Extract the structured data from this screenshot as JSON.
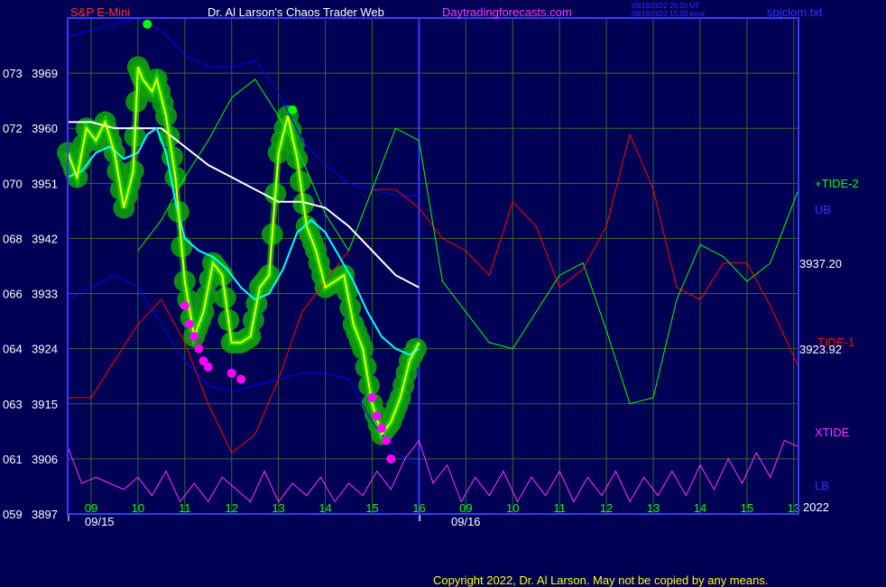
{
  "header": {
    "symbol": "S&P E-Mini",
    "author": "Dr. Al Larson's Chaos Trader Web",
    "site": "Daytradingforecasts.com",
    "timestamp_ut": "09/16/2022 20:20 UT",
    "timestamp_local": "09/16/2022 15:20 local",
    "filename": "spjclom.txt"
  },
  "footer": {
    "copyright": "Copyright 2022, Dr. Al Larson. May not be copied by any means."
  },
  "colors": {
    "background": "#000055",
    "frame": "#3a3aff",
    "grid": "#2f6b2f",
    "price": "#ffff00",
    "bands": "#00ff00",
    "ma_fast": "#00ffff",
    "ma_slow": "#ffffff",
    "tide2": "#00ff00",
    "tide1": "#ff0000",
    "xtide": "#ff33ff",
    "ub_lb": "#0000ff",
    "dots": "#ff00ff"
  },
  "chart_data": {
    "type": "line",
    "title": "S&P E-Mini",
    "y_ticks": [
      {
        "left": "073",
        "value": 3969
      },
      {
        "left": "072",
        "value": 3960
      },
      {
        "left": "070",
        "value": 3951
      },
      {
        "left": "068",
        "value": 3942
      },
      {
        "left": "066",
        "value": 3933
      },
      {
        "left": "064",
        "value": 3924
      },
      {
        "left": "063",
        "value": 3915
      },
      {
        "left": "061",
        "value": 3906
      },
      {
        "left": "059",
        "value": 3897
      }
    ],
    "ylim": [
      3897,
      3978
    ],
    "hour_labels_day1": [
      "09",
      "10",
      "11",
      "12",
      "13",
      "14",
      "15",
      "16"
    ],
    "hour_labels_day2": [
      "09",
      "10",
      "11",
      "12",
      "13",
      "14",
      "15",
      "13"
    ],
    "x_range_hours": [
      8.5,
      24.1
    ],
    "date_labels": [
      "09/15",
      "09/16"
    ],
    "year_label": "2022",
    "day_separator_hour": 16.0,
    "right_labels": {
      "tide2": "+TIDE-2",
      "ub": "UB",
      "price_last": "3937.20",
      "tide1": "TIDE-1",
      "price_now": "3923.92",
      "xtide": "XTIDE",
      "lb": "LB"
    },
    "series": [
      {
        "name": "price",
        "color": "#ffff00",
        "points": [
          [
            8.5,
            3956
          ],
          [
            8.7,
            3952
          ],
          [
            8.9,
            3960
          ],
          [
            9.1,
            3958
          ],
          [
            9.3,
            3961
          ],
          [
            9.5,
            3956
          ],
          [
            9.7,
            3947
          ],
          [
            9.9,
            3953
          ],
          [
            10.0,
            3970
          ],
          [
            10.1,
            3968
          ],
          [
            10.3,
            3966
          ],
          [
            10.4,
            3968
          ],
          [
            10.6,
            3962
          ],
          [
            10.8,
            3952
          ],
          [
            11.0,
            3935
          ],
          [
            11.2,
            3926
          ],
          [
            11.4,
            3930
          ],
          [
            11.6,
            3938
          ],
          [
            11.8,
            3936
          ],
          [
            12.0,
            3925
          ],
          [
            12.2,
            3925
          ],
          [
            12.4,
            3926
          ],
          [
            12.6,
            3934
          ],
          [
            12.8,
            3936
          ],
          [
            13.0,
            3956
          ],
          [
            13.2,
            3962
          ],
          [
            13.4,
            3955
          ],
          [
            13.6,
            3944
          ],
          [
            13.8,
            3940
          ],
          [
            14.0,
            3934
          ],
          [
            14.2,
            3935
          ],
          [
            14.4,
            3936
          ],
          [
            14.6,
            3928
          ],
          [
            14.8,
            3924
          ],
          [
            15.0,
            3915
          ],
          [
            15.2,
            3910
          ],
          [
            15.4,
            3912
          ],
          [
            15.6,
            3916
          ],
          [
            15.8,
            3922
          ],
          [
            16.0,
            3925
          ]
        ]
      },
      {
        "name": "ma_fast",
        "color": "#00ffff",
        "points": [
          [
            8.5,
            3952
          ],
          [
            8.8,
            3953
          ],
          [
            9.1,
            3956
          ],
          [
            9.4,
            3957
          ],
          [
            9.7,
            3955
          ],
          [
            10.0,
            3956
          ],
          [
            10.2,
            3959
          ],
          [
            10.4,
            3960
          ],
          [
            10.6,
            3956
          ],
          [
            10.8,
            3948
          ],
          [
            11.0,
            3942
          ],
          [
            11.3,
            3940
          ],
          [
            11.6,
            3939
          ],
          [
            11.9,
            3937
          ],
          [
            12.2,
            3934
          ],
          [
            12.5,
            3932
          ],
          [
            12.8,
            3933
          ],
          [
            13.1,
            3937
          ],
          [
            13.4,
            3943
          ],
          [
            13.7,
            3945
          ],
          [
            14.0,
            3943
          ],
          [
            14.3,
            3939
          ],
          [
            14.6,
            3935
          ],
          [
            14.9,
            3930
          ],
          [
            15.2,
            3926
          ],
          [
            15.5,
            3924
          ],
          [
            15.8,
            3923
          ],
          [
            16.0,
            3924
          ]
        ]
      },
      {
        "name": "ma_slow",
        "color": "#ffffff",
        "points": [
          [
            8.5,
            3961
          ],
          [
            9.0,
            3961
          ],
          [
            9.5,
            3960
          ],
          [
            10.0,
            3960
          ],
          [
            10.5,
            3960
          ],
          [
            11.0,
            3957
          ],
          [
            11.5,
            3954
          ],
          [
            12.0,
            3952
          ],
          [
            12.5,
            3950
          ],
          [
            13.0,
            3948
          ],
          [
            13.5,
            3948
          ],
          [
            14.0,
            3947
          ],
          [
            14.5,
            3944
          ],
          [
            15.0,
            3940
          ],
          [
            15.5,
            3936
          ],
          [
            16.0,
            3934
          ]
        ]
      },
      {
        "name": "ub",
        "color": "#0000ff",
        "points": [
          [
            8.5,
            3975
          ],
          [
            9.0,
            3976
          ],
          [
            9.5,
            3977
          ],
          [
            10.0,
            3978
          ],
          [
            10.5,
            3976
          ],
          [
            11.0,
            3972
          ],
          [
            11.5,
            3970
          ],
          [
            12.0,
            3970
          ],
          [
            12.5,
            3971
          ],
          [
            13.0,
            3966
          ],
          [
            13.5,
            3958
          ],
          [
            14.0,
            3954
          ],
          [
            14.5,
            3951
          ],
          [
            15.0,
            3950
          ],
          [
            15.5,
            3949
          ],
          [
            16.0,
            3949
          ]
        ]
      },
      {
        "name": "lb",
        "color": "#0000ff",
        "points": [
          [
            8.5,
            3932
          ],
          [
            9.0,
            3934
          ],
          [
            9.5,
            3936
          ],
          [
            10.0,
            3934
          ],
          [
            10.5,
            3928
          ],
          [
            11.0,
            3922
          ],
          [
            11.5,
            3918
          ],
          [
            12.0,
            3917
          ],
          [
            12.5,
            3918
          ],
          [
            13.0,
            3919
          ],
          [
            13.5,
            3920
          ],
          [
            14.0,
            3920
          ],
          [
            14.5,
            3919
          ],
          [
            15.0,
            3912
          ],
          [
            15.5,
            3907
          ],
          [
            16.0,
            3905
          ]
        ]
      },
      {
        "name": "+TIDE-2",
        "color": "#00ff00",
        "points": [
          [
            10.0,
            3940
          ],
          [
            10.5,
            3945
          ],
          [
            11.0,
            3952
          ],
          [
            11.5,
            3958
          ],
          [
            12.0,
            3965
          ],
          [
            12.5,
            3968
          ],
          [
            13.0,
            3962
          ],
          [
            13.5,
            3955
          ],
          [
            14.0,
            3946
          ],
          [
            14.5,
            3940
          ],
          [
            15.0,
            3950
          ],
          [
            15.5,
            3960
          ],
          [
            16.0,
            3958
          ],
          [
            16.5,
            3935
          ],
          [
            17.0,
            3930
          ],
          [
            17.5,
            3925
          ],
          [
            18.0,
            3924
          ],
          [
            18.5,
            3930
          ],
          [
            19.0,
            3936
          ],
          [
            19.5,
            3938
          ],
          [
            20.0,
            3927
          ],
          [
            20.5,
            3915
          ],
          [
            21.0,
            3916
          ],
          [
            21.5,
            3932
          ],
          [
            22.0,
            3941
          ],
          [
            22.5,
            3939
          ],
          [
            23.0,
            3935
          ],
          [
            23.5,
            3938
          ],
          [
            24.1,
            3950
          ]
        ]
      },
      {
        "name": "TIDE-1",
        "color": "#ff0000",
        "points": [
          [
            8.5,
            3916
          ],
          [
            9.0,
            3916
          ],
          [
            9.5,
            3922
          ],
          [
            10.0,
            3928
          ],
          [
            10.5,
            3932
          ],
          [
            11.0,
            3925
          ],
          [
            11.5,
            3915
          ],
          [
            12.0,
            3907
          ],
          [
            12.5,
            3910
          ],
          [
            13.0,
            3919
          ],
          [
            13.5,
            3930
          ],
          [
            14.0,
            3935
          ],
          [
            14.5,
            3940
          ],
          [
            15.0,
            3950
          ],
          [
            15.5,
            3950
          ],
          [
            16.0,
            3947
          ],
          [
            16.5,
            3942
          ],
          [
            17.0,
            3940
          ],
          [
            17.5,
            3936
          ],
          [
            18.0,
            3948
          ],
          [
            18.5,
            3944
          ],
          [
            19.0,
            3934
          ],
          [
            19.5,
            3937
          ],
          [
            20.0,
            3944
          ],
          [
            20.5,
            3959
          ],
          [
            21.0,
            3950
          ],
          [
            21.5,
            3934
          ],
          [
            22.0,
            3932
          ],
          [
            22.5,
            3938
          ],
          [
            23.0,
            3938
          ],
          [
            23.5,
            3931
          ],
          [
            24.1,
            3921
          ]
        ]
      },
      {
        "name": "XTIDE",
        "color": "#ff33ff",
        "points": [
          [
            8.5,
            3908
          ],
          [
            8.8,
            3902
          ],
          [
            9.1,
            3903
          ],
          [
            9.4,
            3902
          ],
          [
            9.7,
            3901
          ],
          [
            10.0,
            3903
          ],
          [
            10.3,
            3900
          ],
          [
            10.6,
            3904
          ],
          [
            10.9,
            3899
          ],
          [
            11.2,
            3902
          ],
          [
            11.5,
            3899
          ],
          [
            11.8,
            3903
          ],
          [
            12.1,
            3901
          ],
          [
            12.4,
            3899
          ],
          [
            12.7,
            3904
          ],
          [
            13.0,
            3899
          ],
          [
            13.3,
            3902
          ],
          [
            13.6,
            3900
          ],
          [
            13.9,
            3903
          ],
          [
            14.2,
            3899
          ],
          [
            14.5,
            3902
          ],
          [
            14.8,
            3900
          ],
          [
            15.1,
            3904
          ],
          [
            15.4,
            3901
          ],
          [
            15.7,
            3906
          ],
          [
            16.0,
            3909
          ],
          [
            16.3,
            3902
          ],
          [
            16.6,
            3905
          ],
          [
            16.9,
            3899
          ],
          [
            17.2,
            3903
          ],
          [
            17.5,
            3900
          ],
          [
            17.8,
            3904
          ],
          [
            18.1,
            3899
          ],
          [
            18.4,
            3903
          ],
          [
            18.7,
            3900
          ],
          [
            19.0,
            3904
          ],
          [
            19.3,
            3899
          ],
          [
            19.6,
            3903
          ],
          [
            19.9,
            3900
          ],
          [
            20.2,
            3904
          ],
          [
            20.5,
            3899
          ],
          [
            20.8,
            3903
          ],
          [
            21.1,
            3900
          ],
          [
            21.4,
            3904
          ],
          [
            21.7,
            3900
          ],
          [
            22.0,
            3905
          ],
          [
            22.3,
            3901
          ],
          [
            22.6,
            3906
          ],
          [
            22.9,
            3902
          ],
          [
            23.2,
            3907
          ],
          [
            23.5,
            3903
          ],
          [
            23.8,
            3909
          ],
          [
            24.1,
            3908
          ]
        ]
      }
    ],
    "markers": [
      {
        "name": "magenta-dots",
        "color": "#ff00ff",
        "points": [
          [
            11.0,
            3931
          ],
          [
            11.1,
            3928
          ],
          [
            11.2,
            3926
          ],
          [
            11.3,
            3924
          ],
          [
            11.4,
            3922
          ],
          [
            11.5,
            3921
          ],
          [
            12.0,
            3920
          ],
          [
            12.2,
            3919
          ],
          [
            15.0,
            3916
          ],
          [
            15.1,
            3913
          ],
          [
            15.2,
            3911
          ],
          [
            15.3,
            3909
          ],
          [
            15.4,
            3906
          ]
        ]
      },
      {
        "name": "green-dots",
        "color": "#00ff00",
        "points": [
          [
            10.2,
            3977
          ],
          [
            13.3,
            3963
          ]
        ]
      }
    ]
  }
}
